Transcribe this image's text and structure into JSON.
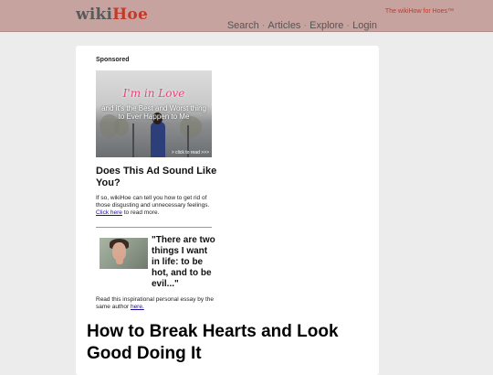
{
  "header": {
    "logo_prefix": "wiki",
    "logo_accent": "Hoe",
    "tagline": "The wikiHow for Hoes™",
    "nav": [
      "Search",
      "Articles",
      "Explore",
      "Login"
    ],
    "nav_separator": "·"
  },
  "sidebar_ad": {
    "sponsored_label": "Sponsored",
    "image_script": "I'm in Love",
    "image_text": "and it's the Best and Worst thing to Ever Happen to Me",
    "image_click": "> click to read >>>",
    "headline": "Does This Ad Sound Like You?",
    "desc_prefix": "If so, wikiHoe can tell you how to get rid of those disgusting and unnecessary feelings.",
    "desc_link": "Click here",
    "desc_suffix": "to read more."
  },
  "essay_promo": {
    "quote": "\"There are two things I want in life: to be hot, and to be evil...\"",
    "desc_prefix": "Read this inspirational personal essay by the same author",
    "desc_link": "here."
  },
  "article": {
    "title": "How to Break Hearts and Look Good Doing It"
  },
  "colors": {
    "header_bg": "#c7a3a0",
    "accent": "#c0392b",
    "page_bg": "#ececec",
    "link": "#1a0dab"
  }
}
